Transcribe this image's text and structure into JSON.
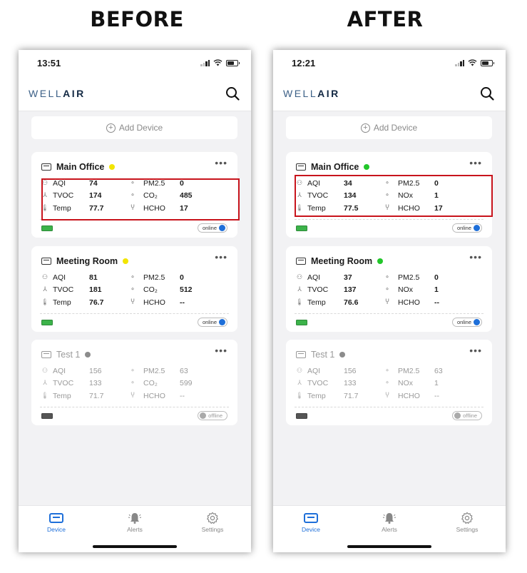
{
  "headings": {
    "before": "BEFORE",
    "after": "AFTER"
  },
  "colors": {
    "accent": "#1e6fd9",
    "highlight_box": "#c8141c",
    "status_yellow": "#f2e500",
    "status_green": "#22c62a",
    "status_gray": "#8c8c8c"
  },
  "before": {
    "status_bar": {
      "time": "13:51"
    },
    "header": {
      "logo_a": "WELL",
      "logo_b": "AIR",
      "search_icon": "search-icon"
    },
    "add_device": "Add Device",
    "cards": [
      {
        "name": "Main Office",
        "status_color": "#f2e500",
        "rows": [
          {
            "l1": "AQI",
            "v1": "74",
            "l2": "PM2.5",
            "v2": "0"
          },
          {
            "l1": "TVOC",
            "v1": "174",
            "l2": "CO₂",
            "v2": "485"
          },
          {
            "l1": "Temp",
            "v1": "77.7",
            "l2": "HCHO",
            "v2": "17"
          }
        ],
        "connection": "online"
      },
      {
        "name": "Meeting Room",
        "status_color": "#f2e500",
        "rows": [
          {
            "l1": "AQI",
            "v1": "81",
            "l2": "PM2.5",
            "v2": "0"
          },
          {
            "l1": "TVOC",
            "v1": "181",
            "l2": "CO₂",
            "v2": "512"
          },
          {
            "l1": "Temp",
            "v1": "76.7",
            "l2": "HCHO",
            "v2": "--"
          }
        ],
        "connection": "online"
      },
      {
        "name": "Test 1",
        "status_color": "#8c8c8c",
        "rows": [
          {
            "l1": "AQI",
            "v1": "156",
            "l2": "PM2.5",
            "v2": "63"
          },
          {
            "l1": "TVOC",
            "v1": "133",
            "l2": "CO₂",
            "v2": "599"
          },
          {
            "l1": "Temp",
            "v1": "71.7",
            "l2": "HCHO",
            "v2": "--"
          }
        ],
        "connection": "offline"
      }
    ],
    "tabs": [
      {
        "label": "Device"
      },
      {
        "label": "Alerts"
      },
      {
        "label": "Settings"
      }
    ]
  },
  "after": {
    "status_bar": {
      "time": "12:21"
    },
    "header": {
      "logo_a": "WELL",
      "logo_b": "AIR",
      "search_icon": "search-icon"
    },
    "add_device": "Add Device",
    "cards": [
      {
        "name": "Main Office",
        "status_color": "#22c62a",
        "rows": [
          {
            "l1": "AQI",
            "v1": "34",
            "l2": "PM2.5",
            "v2": "0"
          },
          {
            "l1": "TVOC",
            "v1": "134",
            "l2": "NOx",
            "v2": "1"
          },
          {
            "l1": "Temp",
            "v1": "77.5",
            "l2": "HCHO",
            "v2": "17"
          }
        ],
        "connection": "online"
      },
      {
        "name": "Meeting Room",
        "status_color": "#22c62a",
        "rows": [
          {
            "l1": "AQI",
            "v1": "37",
            "l2": "PM2.5",
            "v2": "0"
          },
          {
            "l1": "TVOC",
            "v1": "137",
            "l2": "NOx",
            "v2": "1"
          },
          {
            "l1": "Temp",
            "v1": "76.6",
            "l2": "HCHO",
            "v2": "--"
          }
        ],
        "connection": "online"
      },
      {
        "name": "Test 1",
        "status_color": "#8c8c8c",
        "rows": [
          {
            "l1": "AQI",
            "v1": "156",
            "l2": "PM2.5",
            "v2": "63"
          },
          {
            "l1": "TVOC",
            "v1": "133",
            "l2": "NOx",
            "v2": "1"
          },
          {
            "l1": "Temp",
            "v1": "71.7",
            "l2": "HCHO",
            "v2": "--"
          }
        ],
        "connection": "offline"
      }
    ],
    "tabs": [
      {
        "label": "Device"
      },
      {
        "label": "Alerts"
      },
      {
        "label": "Settings"
      }
    ]
  }
}
